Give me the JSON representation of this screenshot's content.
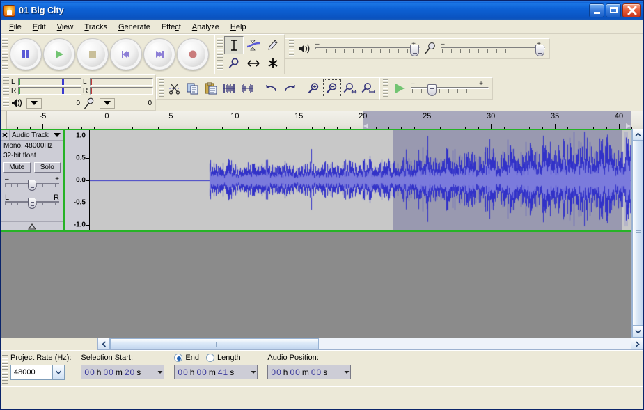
{
  "window": {
    "title": "01 Big City",
    "icon": "audacity-logo-icon",
    "minimize_label": "Minimize",
    "maximize_label": "Maximize",
    "close_label": "Close"
  },
  "menubar": {
    "items": [
      {
        "label": "File",
        "accel": "F"
      },
      {
        "label": "Edit",
        "accel": "E"
      },
      {
        "label": "View",
        "accel": "V"
      },
      {
        "label": "Tracks",
        "accel": "T"
      },
      {
        "label": "Generate",
        "accel": "G"
      },
      {
        "label": "Effect",
        "accel": "c"
      },
      {
        "label": "Analyze",
        "accel": "A"
      },
      {
        "label": "Help",
        "accel": "H"
      }
    ]
  },
  "transport": {
    "buttons": [
      {
        "name": "pause-button",
        "label": "Pause"
      },
      {
        "name": "play-button",
        "label": "Play"
      },
      {
        "name": "stop-button",
        "label": "Stop"
      },
      {
        "name": "skip-to-start-button",
        "label": "Skip to Start"
      },
      {
        "name": "skip-to-end-button",
        "label": "Skip to End"
      },
      {
        "name": "record-button",
        "label": "Record"
      }
    ]
  },
  "meters": {
    "output": {
      "label": "Output Meter",
      "left_channel": "L",
      "right_channel": "R",
      "scale_max": "0",
      "icon": "speaker-icon"
    },
    "input": {
      "label": "Input Meter",
      "left_channel": "L",
      "right_channel": "R",
      "scale_max": "0",
      "icon": "microphone-icon"
    }
  },
  "tools": {
    "items": [
      {
        "name": "selection-tool",
        "label": "Selection Tool",
        "selected": true
      },
      {
        "name": "envelope-tool",
        "label": "Envelope Tool",
        "selected": false
      },
      {
        "name": "draw-tool",
        "label": "Draw Tool",
        "selected": false
      },
      {
        "name": "zoom-tool",
        "label": "Zoom Tool",
        "selected": false
      },
      {
        "name": "time-shift-tool",
        "label": "Time Shift Tool",
        "selected": false
      },
      {
        "name": "multi-tool",
        "label": "Multi-Tool",
        "selected": false
      }
    ]
  },
  "mixer": {
    "output_volume": {
      "label": "Output Volume",
      "minus": "–",
      "plus": "+",
      "value_pct": 100
    },
    "input_volume": {
      "label": "Input Volume",
      "minus": "–",
      "plus": "+",
      "value_pct": 100
    }
  },
  "edit_toolbar": {
    "buttons": [
      {
        "name": "cut-button",
        "label": "Cut"
      },
      {
        "name": "copy-button",
        "label": "Copy"
      },
      {
        "name": "paste-button",
        "label": "Paste"
      },
      {
        "name": "trim-outside-selection-button",
        "label": "Trim Outside Selection"
      },
      {
        "name": "silence-selection-button",
        "label": "Silence Selection"
      },
      {
        "name": "undo-button",
        "label": "Undo"
      },
      {
        "name": "redo-button",
        "label": "Redo"
      },
      {
        "name": "zoom-in-button",
        "label": "Zoom In"
      },
      {
        "name": "zoom-out-button",
        "label": "Zoom Out",
        "focused": true
      },
      {
        "name": "fit-selection-button",
        "label": "Fit Selection"
      },
      {
        "name": "fit-project-button",
        "label": "Fit Project"
      }
    ]
  },
  "play_at_speed": {
    "button_label": "Play-at-Speed",
    "slider": {
      "label": "Playback Speed",
      "minus": "–",
      "plus": "+",
      "value_pct": 28
    }
  },
  "ruler": {
    "unit": "seconds",
    "labels": [
      "-5",
      "0",
      "5",
      "10",
      "15",
      "20",
      "25",
      "30",
      "35",
      "40"
    ],
    "label_values": [
      -5,
      0,
      5,
      10,
      15,
      20,
      25,
      30,
      35,
      40
    ],
    "start_value": -7.8,
    "end_value": 41.9,
    "selection_start": 20,
    "selection_end": 41
  },
  "track": {
    "close_label": "✕",
    "name": "Audio Track",
    "menu_icon": "chevron-down-icon",
    "channels_info": "Mono, 48000Hz",
    "format_info": "32-bit float",
    "mute_label": "Mute",
    "solo_label": "Solo",
    "gain_slider": {
      "label": "Gain",
      "minus": "–",
      "plus": "+",
      "value": 0
    },
    "pan_slider": {
      "label": "Pan",
      "left": "L",
      "right": "R",
      "value": 0
    },
    "collapse_icon": "collapse-triangle-icon",
    "vertical_ruler": {
      "labels": [
        "1.0",
        "0.5",
        "0.0",
        "-0.5",
        "-1.0"
      ],
      "values": [
        1.0,
        0.5,
        0.0,
        -0.5,
        -1.0
      ]
    }
  },
  "waveform": {
    "audio_start_seconds": 3.2,
    "audio_end_seconds": 41.8,
    "background_color": "#c8c8c8",
    "selected_background_color": "#9999b0",
    "wave_color": "#3232c8",
    "rms_color": "#7b7bdc",
    "track_border_color": "#26b326"
  },
  "scrollbars": {
    "horizontal": {
      "left_arrow": "◀",
      "right_arrow": "▶"
    },
    "vertical": {
      "up_arrow": "▲",
      "down_arrow": "▼"
    }
  },
  "selection_bar": {
    "project_rate_label": "Project Rate (Hz):",
    "project_rate_value": "48000",
    "selection_start_label": "Selection Start:",
    "end_radio_label": "End",
    "length_radio_label": "Length",
    "end_selected": true,
    "audio_position_label": "Audio Position:",
    "selection_start_time": {
      "hours": "00",
      "h": "h",
      "minutes": "00",
      "m": "m",
      "seconds": "20",
      "s": "s"
    },
    "selection_end_time": {
      "hours": "00",
      "h": "h",
      "minutes": "00",
      "m": "m",
      "seconds": "41",
      "s": "s"
    },
    "audio_position_time": {
      "hours": "00",
      "h": "h",
      "minutes": "00",
      "m": "m",
      "seconds": "00",
      "s": "s"
    }
  }
}
